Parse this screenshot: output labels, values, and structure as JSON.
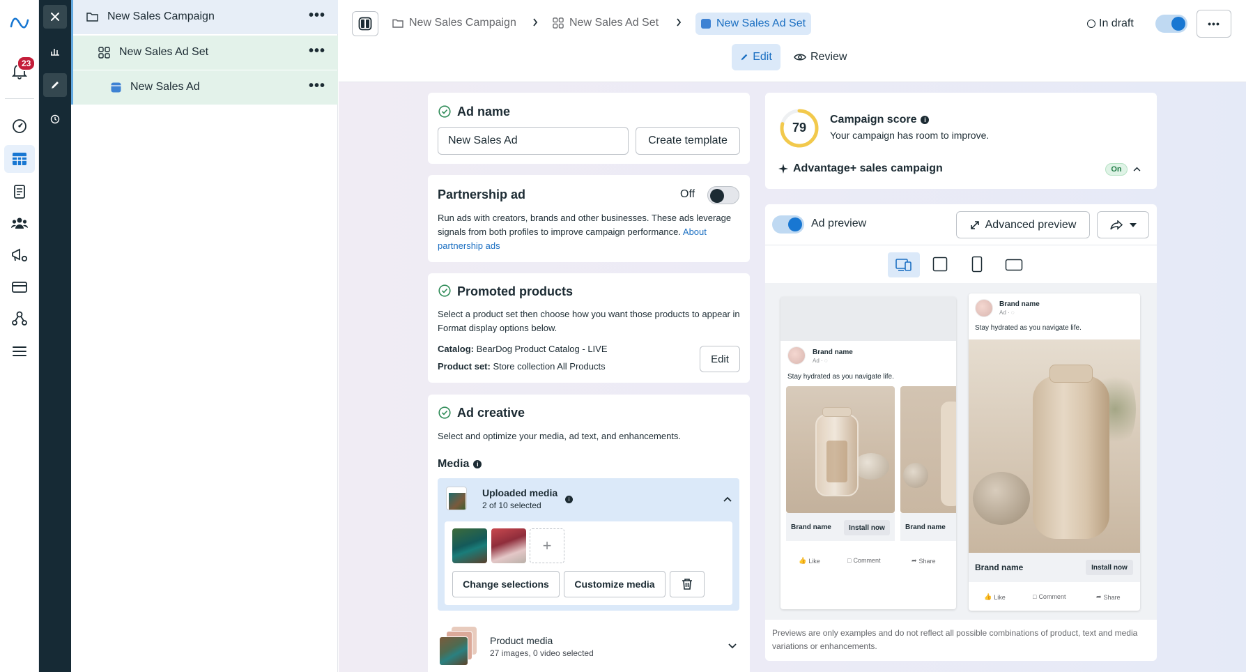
{
  "leftnav": {
    "notifications_count": "23"
  },
  "tree": {
    "campaign": "New Sales Campaign",
    "adset": "New Sales Ad Set",
    "ad": "New Sales Ad",
    "more": "•••"
  },
  "breadcrumbs": {
    "campaign": "New Sales Campaign",
    "adset": "New Sales Ad Set",
    "active": "New Sales Ad Set"
  },
  "topbar": {
    "status": "In draft",
    "status_toggle_on": true,
    "more": "•••",
    "edit_tab": "Edit",
    "review_tab": "Review"
  },
  "ad_name": {
    "title": "Ad name",
    "value": "New Sales Ad",
    "create_template": "Create template"
  },
  "partnership": {
    "title": "Partnership ad",
    "toggle_label": "Off",
    "description": "Run ads with creators, brands and other businesses. These ads leverage signals from both profiles to improve campaign performance.",
    "link": "About partnership ads"
  },
  "promoted_products": {
    "title": "Promoted products",
    "description": "Select a product set then choose how you want those products to appear in Format display options below.",
    "catalog_label": "Catalog:",
    "catalog_value": "BearDog Product Catalog - LIVE",
    "product_set_label": "Product set:",
    "product_set_value": "Store collection All Products",
    "edit": "Edit"
  },
  "ad_creative": {
    "title": "Ad creative",
    "description": "Select and optimize your media, ad text, and enhancements.",
    "media_label": "Media",
    "uploaded_title": "Uploaded media",
    "uploaded_sub": "2 of 10 selected",
    "add_symbol": "+",
    "change_selections": "Change selections",
    "customize_media": "Customize media",
    "product_media_title": "Product media",
    "product_media_sub": "27 images, 0 video selected"
  },
  "campaign_score": {
    "score": "79",
    "score_fraction": 0.79,
    "title": "Campaign score",
    "subtitle": "Your campaign has room to improve.",
    "advantage": "Advantage+ sales campaign",
    "advantage_status": "On"
  },
  "preview": {
    "toggle_label": "Ad preview",
    "advanced": "Advanced preview",
    "brand": "Brand name",
    "ad_label": "Ad · ◌",
    "caption": "Stay hydrated as you navigate life.",
    "install": "Install now",
    "like": "Like",
    "comment": "Comment",
    "share": "Share",
    "disclaimer": "Previews are only examples and do not reflect all possible combinations of product, text and media variations or enhancements."
  },
  "colors": {
    "accent": "#1877d2",
    "success": "#2e8b57",
    "score_ring": "#f2c94c"
  }
}
